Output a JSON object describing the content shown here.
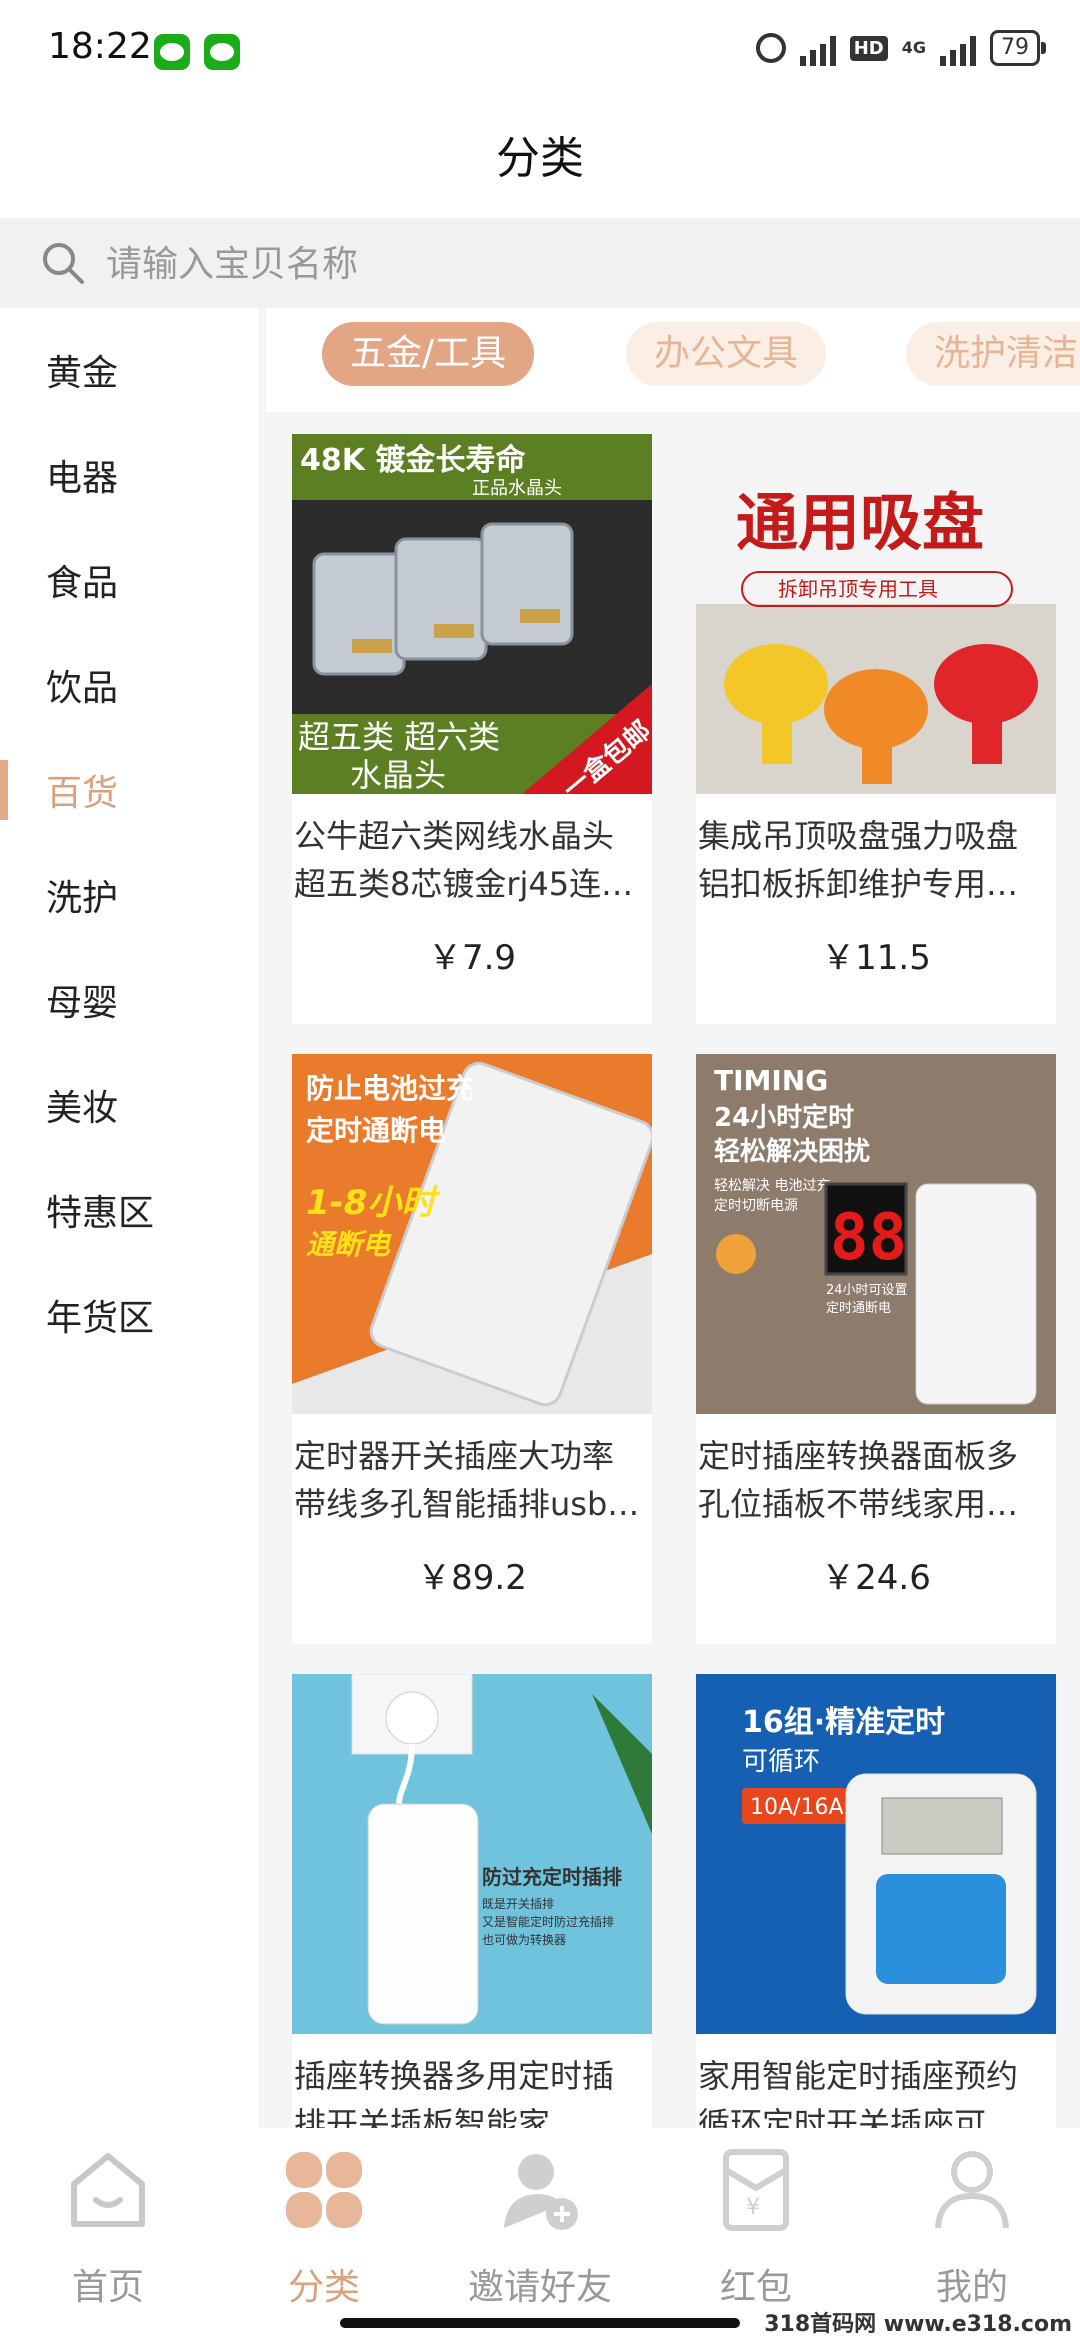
{
  "status": {
    "time": "18:22",
    "hd": "HD",
    "net": "4G",
    "battery": "79"
  },
  "header": {
    "title": "分类"
  },
  "search": {
    "placeholder": "请输入宝贝名称"
  },
  "sidebar": {
    "items": [
      {
        "label": "黄金"
      },
      {
        "label": "电器"
      },
      {
        "label": "食品"
      },
      {
        "label": "饮品"
      },
      {
        "label": "百货"
      },
      {
        "label": "洗护"
      },
      {
        "label": "母婴"
      },
      {
        "label": "美妆"
      },
      {
        "label": "特惠区"
      },
      {
        "label": "年货区"
      }
    ],
    "active_index": 4
  },
  "tabs": [
    {
      "label": "五金/工具"
    },
    {
      "label": "办公文具"
    },
    {
      "label": "洗护清洁"
    }
  ],
  "products": [
    {
      "name": "公牛超六类网线水晶头超五类8芯镀金rj45连…",
      "price": "￥7.9",
      "img": {
        "top": "48K 镀金长寿命",
        "top2": "正品水晶头",
        "bottom": "超五类 超六类",
        "bottom2": "水晶头",
        "tag": "一盒包邮"
      }
    },
    {
      "name": "集成吊顶吸盘强力吸盘铝扣板拆卸维护专用…",
      "price": "￥11.5",
      "img": {
        "title": "通用吸盘",
        "sub": "拆卸吊顶专用工具"
      }
    },
    {
      "name": "定时器开关插座大功率带线多孔智能插排usb…",
      "price": "￥89.2",
      "img": {
        "line1": "防止电池过充",
        "line2": "定时通断电",
        "badge1": "1-8小时",
        "badge2": "通断电"
      }
    },
    {
      "name": "定时插座转换器面板多孔位插板不带线家用…",
      "price": "￥24.6",
      "img": {
        "en": "TIMING",
        "line1": "24小时定时",
        "line2": "轻松解决困扰",
        "small1": "轻松解决 电池过充",
        "small2": "定时切断电源",
        "digits": "88",
        "note1": "24小时可设置",
        "note2": "定时通断电"
      }
    },
    {
      "name": "插座转换器多用定时插排开关插板智能家…",
      "price": "",
      "img": {
        "line1": "防过充定时插排",
        "s1": "既是开关插排",
        "s2": "又是智能定时防过充插排",
        "s3": "也可做为转换器"
      }
    },
    {
      "name": "家用智能定时插座预约循环定时开关插座可…",
      "price": "",
      "img": {
        "title": "16组·精准定时",
        "sub": "可循环",
        "tag": "10A/16A"
      }
    }
  ],
  "tabbar": [
    {
      "label": "首页",
      "icon": "home-icon"
    },
    {
      "label": "分类",
      "icon": "category-icon"
    },
    {
      "label": "邀请好友",
      "icon": "invite-friend-icon"
    },
    {
      "label": "红包",
      "icon": "red-packet-icon"
    },
    {
      "label": "我的",
      "icon": "profile-icon"
    }
  ],
  "watermark": "318首码网 www.e318.com",
  "colors": {
    "accent": "#e2a685",
    "accent_text": "#d9a27c",
    "tab_inactive_bg": "#fbeee4"
  }
}
